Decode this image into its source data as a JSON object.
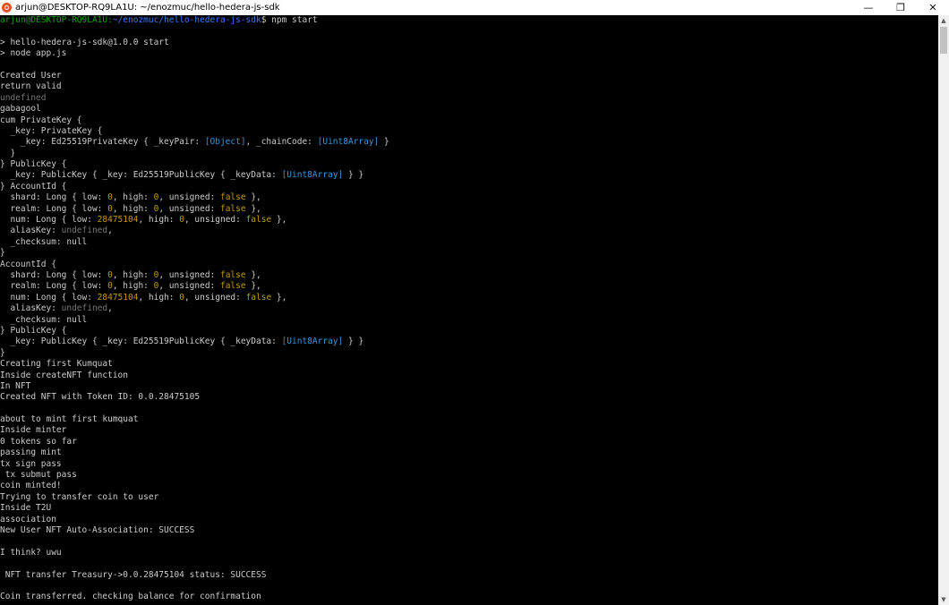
{
  "window": {
    "title": "arjun@DESKTOP-RQ9LA1U: ~/enozmuc/hello-hedera-js-sdk",
    "app_icon": "ubuntu-icon",
    "minimize_glyph": "—",
    "maximize_glyph": "❐",
    "close_glyph": "✕"
  },
  "colors": {
    "background": "#000000",
    "text": "#cccccc",
    "prompt_user": "#13a10e",
    "prompt_path": "#3b78ff",
    "undefined": "#767676",
    "number": "#c19c00",
    "special": "#3a96dd"
  },
  "terminal": {
    "lines": [
      [
        [
          "arjun@DESKTOP-RQ9LA1U:",
          "green"
        ],
        [
          "~/enozmuc/hello-hedera-js-sdk",
          "blue"
        ],
        [
          "$ npm start",
          "white"
        ]
      ],
      [],
      [
        [
          "> hello-hedera-js-sdk@1.0.0 start",
          "white"
        ]
      ],
      [
        [
          "> node app.js",
          "white"
        ]
      ],
      [],
      [
        [
          "Created User",
          "white"
        ]
      ],
      [
        [
          "return valid",
          "white"
        ]
      ],
      [
        [
          "undefined",
          "gray"
        ]
      ],
      [
        [
          "gabagool",
          "white"
        ]
      ],
      [
        [
          "cum PrivateKey {",
          "white"
        ]
      ],
      [
        [
          "  _key: PrivateKey {",
          "white"
        ]
      ],
      [
        [
          "    _key: Ed25519PrivateKey { _keyPair: ",
          "white"
        ],
        [
          "[Object]",
          "cyan"
        ],
        [
          ", _chainCode: ",
          "white"
        ],
        [
          "[Uint8Array]",
          "cyan"
        ],
        [
          " }",
          "white"
        ]
      ],
      [
        [
          "  }",
          "white"
        ]
      ],
      [
        [
          "} PublicKey {",
          "white"
        ]
      ],
      [
        [
          "  _key: PublicKey { _key: Ed25519PublicKey { _keyData: ",
          "white"
        ],
        [
          "[Uint8Array]",
          "cyan"
        ],
        [
          " } }",
          "white"
        ]
      ],
      [
        [
          "} AccountId {",
          "white"
        ]
      ],
      [
        [
          "  shard: Long { low: ",
          "white"
        ],
        [
          "0",
          "yellow"
        ],
        [
          ", high: ",
          "white"
        ],
        [
          "0",
          "yellow"
        ],
        [
          ", unsigned: ",
          "white"
        ],
        [
          "false",
          "yellow"
        ],
        [
          " },",
          "white"
        ]
      ],
      [
        [
          "  realm: Long { low: ",
          "white"
        ],
        [
          "0",
          "yellow"
        ],
        [
          ", high: ",
          "white"
        ],
        [
          "0",
          "yellow"
        ],
        [
          ", unsigned: ",
          "white"
        ],
        [
          "false",
          "yellow"
        ],
        [
          " },",
          "white"
        ]
      ],
      [
        [
          "  num: Long { low: ",
          "white"
        ],
        [
          "28475104",
          "yellow"
        ],
        [
          ", high: ",
          "white"
        ],
        [
          "0",
          "yellow"
        ],
        [
          ", unsigned: ",
          "white"
        ],
        [
          "false",
          "yellow"
        ],
        [
          " },",
          "white"
        ]
      ],
      [
        [
          "  aliasKey: ",
          "white"
        ],
        [
          "undefined",
          "gray"
        ],
        [
          ",",
          "white"
        ]
      ],
      [
        [
          "  _checksum: null",
          "white"
        ]
      ],
      [
        [
          "}",
          "white"
        ]
      ],
      [
        [
          "AccountId {",
          "white"
        ]
      ],
      [
        [
          "  shard: Long { low: ",
          "white"
        ],
        [
          "0",
          "yellow"
        ],
        [
          ", high: ",
          "white"
        ],
        [
          "0",
          "yellow"
        ],
        [
          ", unsigned: ",
          "white"
        ],
        [
          "false",
          "yellow"
        ],
        [
          " },",
          "white"
        ]
      ],
      [
        [
          "  realm: Long { low: ",
          "white"
        ],
        [
          "0",
          "yellow"
        ],
        [
          ", high: ",
          "white"
        ],
        [
          "0",
          "yellow"
        ],
        [
          ", unsigned: ",
          "white"
        ],
        [
          "false",
          "yellow"
        ],
        [
          " },",
          "white"
        ]
      ],
      [
        [
          "  num: Long { low: ",
          "white"
        ],
        [
          "28475104",
          "yellow"
        ],
        [
          ", high: ",
          "white"
        ],
        [
          "0",
          "yellow"
        ],
        [
          ", unsigned: ",
          "white"
        ],
        [
          "false",
          "yellow"
        ],
        [
          " },",
          "white"
        ]
      ],
      [
        [
          "  aliasKey: ",
          "white"
        ],
        [
          "undefined",
          "gray"
        ],
        [
          ",",
          "white"
        ]
      ],
      [
        [
          "  _checksum: null",
          "white"
        ]
      ],
      [
        [
          "} PublicKey {",
          "white"
        ]
      ],
      [
        [
          "  _key: PublicKey { _key: Ed25519PublicKey { _keyData: ",
          "white"
        ],
        [
          "[Uint8Array]",
          "cyan"
        ],
        [
          " } }",
          "white"
        ]
      ],
      [
        [
          "}",
          "white"
        ]
      ],
      [
        [
          "Creating first Kumquat",
          "white"
        ]
      ],
      [
        [
          "Inside createNFT function",
          "white"
        ]
      ],
      [
        [
          "In NFT",
          "white"
        ]
      ],
      [
        [
          "Created NFT with Token ID: 0.0.28475105",
          "white"
        ]
      ],
      [],
      [
        [
          "about to mint first kumquat",
          "white"
        ]
      ],
      [
        [
          "Inside minter",
          "white"
        ]
      ],
      [
        [
          "0 tokens so far",
          "white"
        ]
      ],
      [
        [
          "passing mint",
          "white"
        ]
      ],
      [
        [
          "tx sign pass",
          "white"
        ]
      ],
      [
        [
          " tx submut pass",
          "white"
        ]
      ],
      [
        [
          "coin minted!",
          "white"
        ]
      ],
      [
        [
          "Trying to transfer coin to user",
          "white"
        ]
      ],
      [
        [
          "Inside T2U",
          "white"
        ]
      ],
      [
        [
          "association",
          "white"
        ]
      ],
      [
        [
          "New User NFT Auto-Association: SUCCESS",
          "white"
        ]
      ],
      [],
      [
        [
          "I think? uwu",
          "white"
        ]
      ],
      [],
      [
        [
          " NFT transfer Treasury->0.0.28475104 status: SUCCESS",
          "white"
        ]
      ],
      [],
      [
        [
          "Coin transferred. checking balance for confirmation",
          "white"
        ]
      ]
    ]
  },
  "scrollbar": {
    "up_glyph": "▲",
    "down_glyph": "▼"
  }
}
